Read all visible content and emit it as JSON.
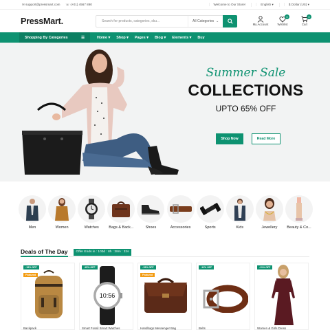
{
  "topbar": {
    "email": "support@pressmart.com",
    "phone": "(+01) 4567 890",
    "welcome": "Welcome to Our Store!",
    "language": "English",
    "currency": "$ Dollar (US)"
  },
  "header": {
    "logo": "PressMart.",
    "search_placeholder": "Search for products, categories, sku...",
    "category_select": "All Categories",
    "account_label": "My Account",
    "wishlist_label": "Wishlist",
    "wishlist_count": "0",
    "cart_label": "Cart",
    "cart_count": "0"
  },
  "nav": {
    "categories_label": "Shopping By Categories",
    "items": [
      "Home",
      "Shop",
      "Pages",
      "Blog",
      "Elements",
      "Buy"
    ]
  },
  "hero": {
    "script_title": "Summer Sale",
    "title": "COLLECTIONS",
    "subtitle": "UPTO 65% OFF",
    "btn_primary": "Shop Now",
    "btn_secondary": "Read More"
  },
  "categories": [
    {
      "label": "Men",
      "icon": "men-icon"
    },
    {
      "label": "Women",
      "icon": "women-icon"
    },
    {
      "label": "Watches",
      "icon": "watch-icon"
    },
    {
      "label": "Bags & Back...",
      "icon": "bag-icon"
    },
    {
      "label": "Shoes",
      "icon": "shoe-icon"
    },
    {
      "label": "Accessories",
      "icon": "belt-icon"
    },
    {
      "label": "Sports",
      "icon": "sports-icon"
    },
    {
      "label": "Kids",
      "icon": "kids-icon"
    },
    {
      "label": "Jewellery",
      "icon": "jewellery-icon"
    },
    {
      "label": "Beauty & Co...",
      "icon": "beauty-icon"
    }
  ],
  "deals": {
    "title": "Deals of The Day",
    "offer": "Offer Ends in : 103d : 8h : 38m : 32s"
  },
  "products": [
    {
      "tags": [
        "-15% OFF",
        "Featured"
      ],
      "name": "Backpack"
    },
    {
      "tags": [
        "-15% OFF"
      ],
      "name": "Smart Fossil Smart Watches"
    },
    {
      "tags": [
        "-15% OFF",
        "Featured"
      ],
      "name": "Handbags Messenger Bag"
    },
    {
      "tags": [
        "-11% OFF"
      ],
      "name": "Belts"
    },
    {
      "tags": [
        "-11% OFF"
      ],
      "name": "Women & Girls Dress"
    }
  ],
  "colors": {
    "accent": "#0e9271",
    "orange": "#f39c12"
  }
}
